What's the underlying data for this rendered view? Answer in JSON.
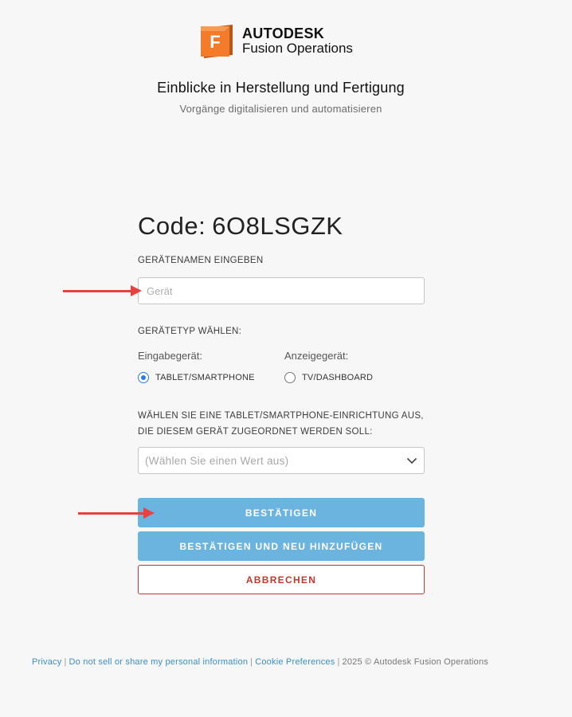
{
  "logo": {
    "brand": "AUTODESK",
    "product": "Fusion Operations",
    "mark_letter": "F"
  },
  "hero": {
    "title": "Einblicke in Herstellung und Fertigung",
    "subtitle": "Vorgänge digitalisieren und automatisieren"
  },
  "form": {
    "code_label": "Code:",
    "code_value": "6O8LSGZK",
    "device_name_label": "GERÄTENAMEN EINGEBEN",
    "device_name_placeholder": "Gerät",
    "device_name_value": "",
    "device_type_label": "GERÄTETYP WÄHLEN:",
    "input_device_caption": "Eingabegerät:",
    "display_device_caption": "Anzeigegerät:",
    "radio_tablet": "TABLET/SMARTPHONE",
    "radio_tv": "TV/DASHBOARD",
    "selected_type": "tablet",
    "setup_label_line1": "WÄHLEN SIE EINE TABLET/SMARTPHONE-EINRICHTUNG AUS,",
    "setup_label_line2": "DIE DIESEM GERÄT ZUGEORDNET WERDEN SOLL:",
    "setup_select_placeholder": "(Wählen Sie einen Wert aus)"
  },
  "buttons": {
    "confirm": "BESTÄTIGEN",
    "confirm_add": "BESTÄTIGEN UND NEU HINZUFÜGEN",
    "cancel": "ABBRECHEN"
  },
  "footer": {
    "privacy": "Privacy",
    "do_not_sell": "Do not sell or share my personal information",
    "cookie": "Cookie Preferences",
    "copyright": "2025 © Autodesk Fusion Operations"
  },
  "colors": {
    "primary_button": "#6cb4e0",
    "cancel": "#c0392b",
    "radio_accent": "#2c7be5",
    "link": "#3b8fc4",
    "annotation_arrow": "#e8413f",
    "logo_orange": "#f37b2a"
  },
  "icons": {
    "logo": "autodesk-fusion-logo-icon",
    "select_chevron": "chevron-down-icon",
    "annotation": "red-arrow-icon"
  }
}
